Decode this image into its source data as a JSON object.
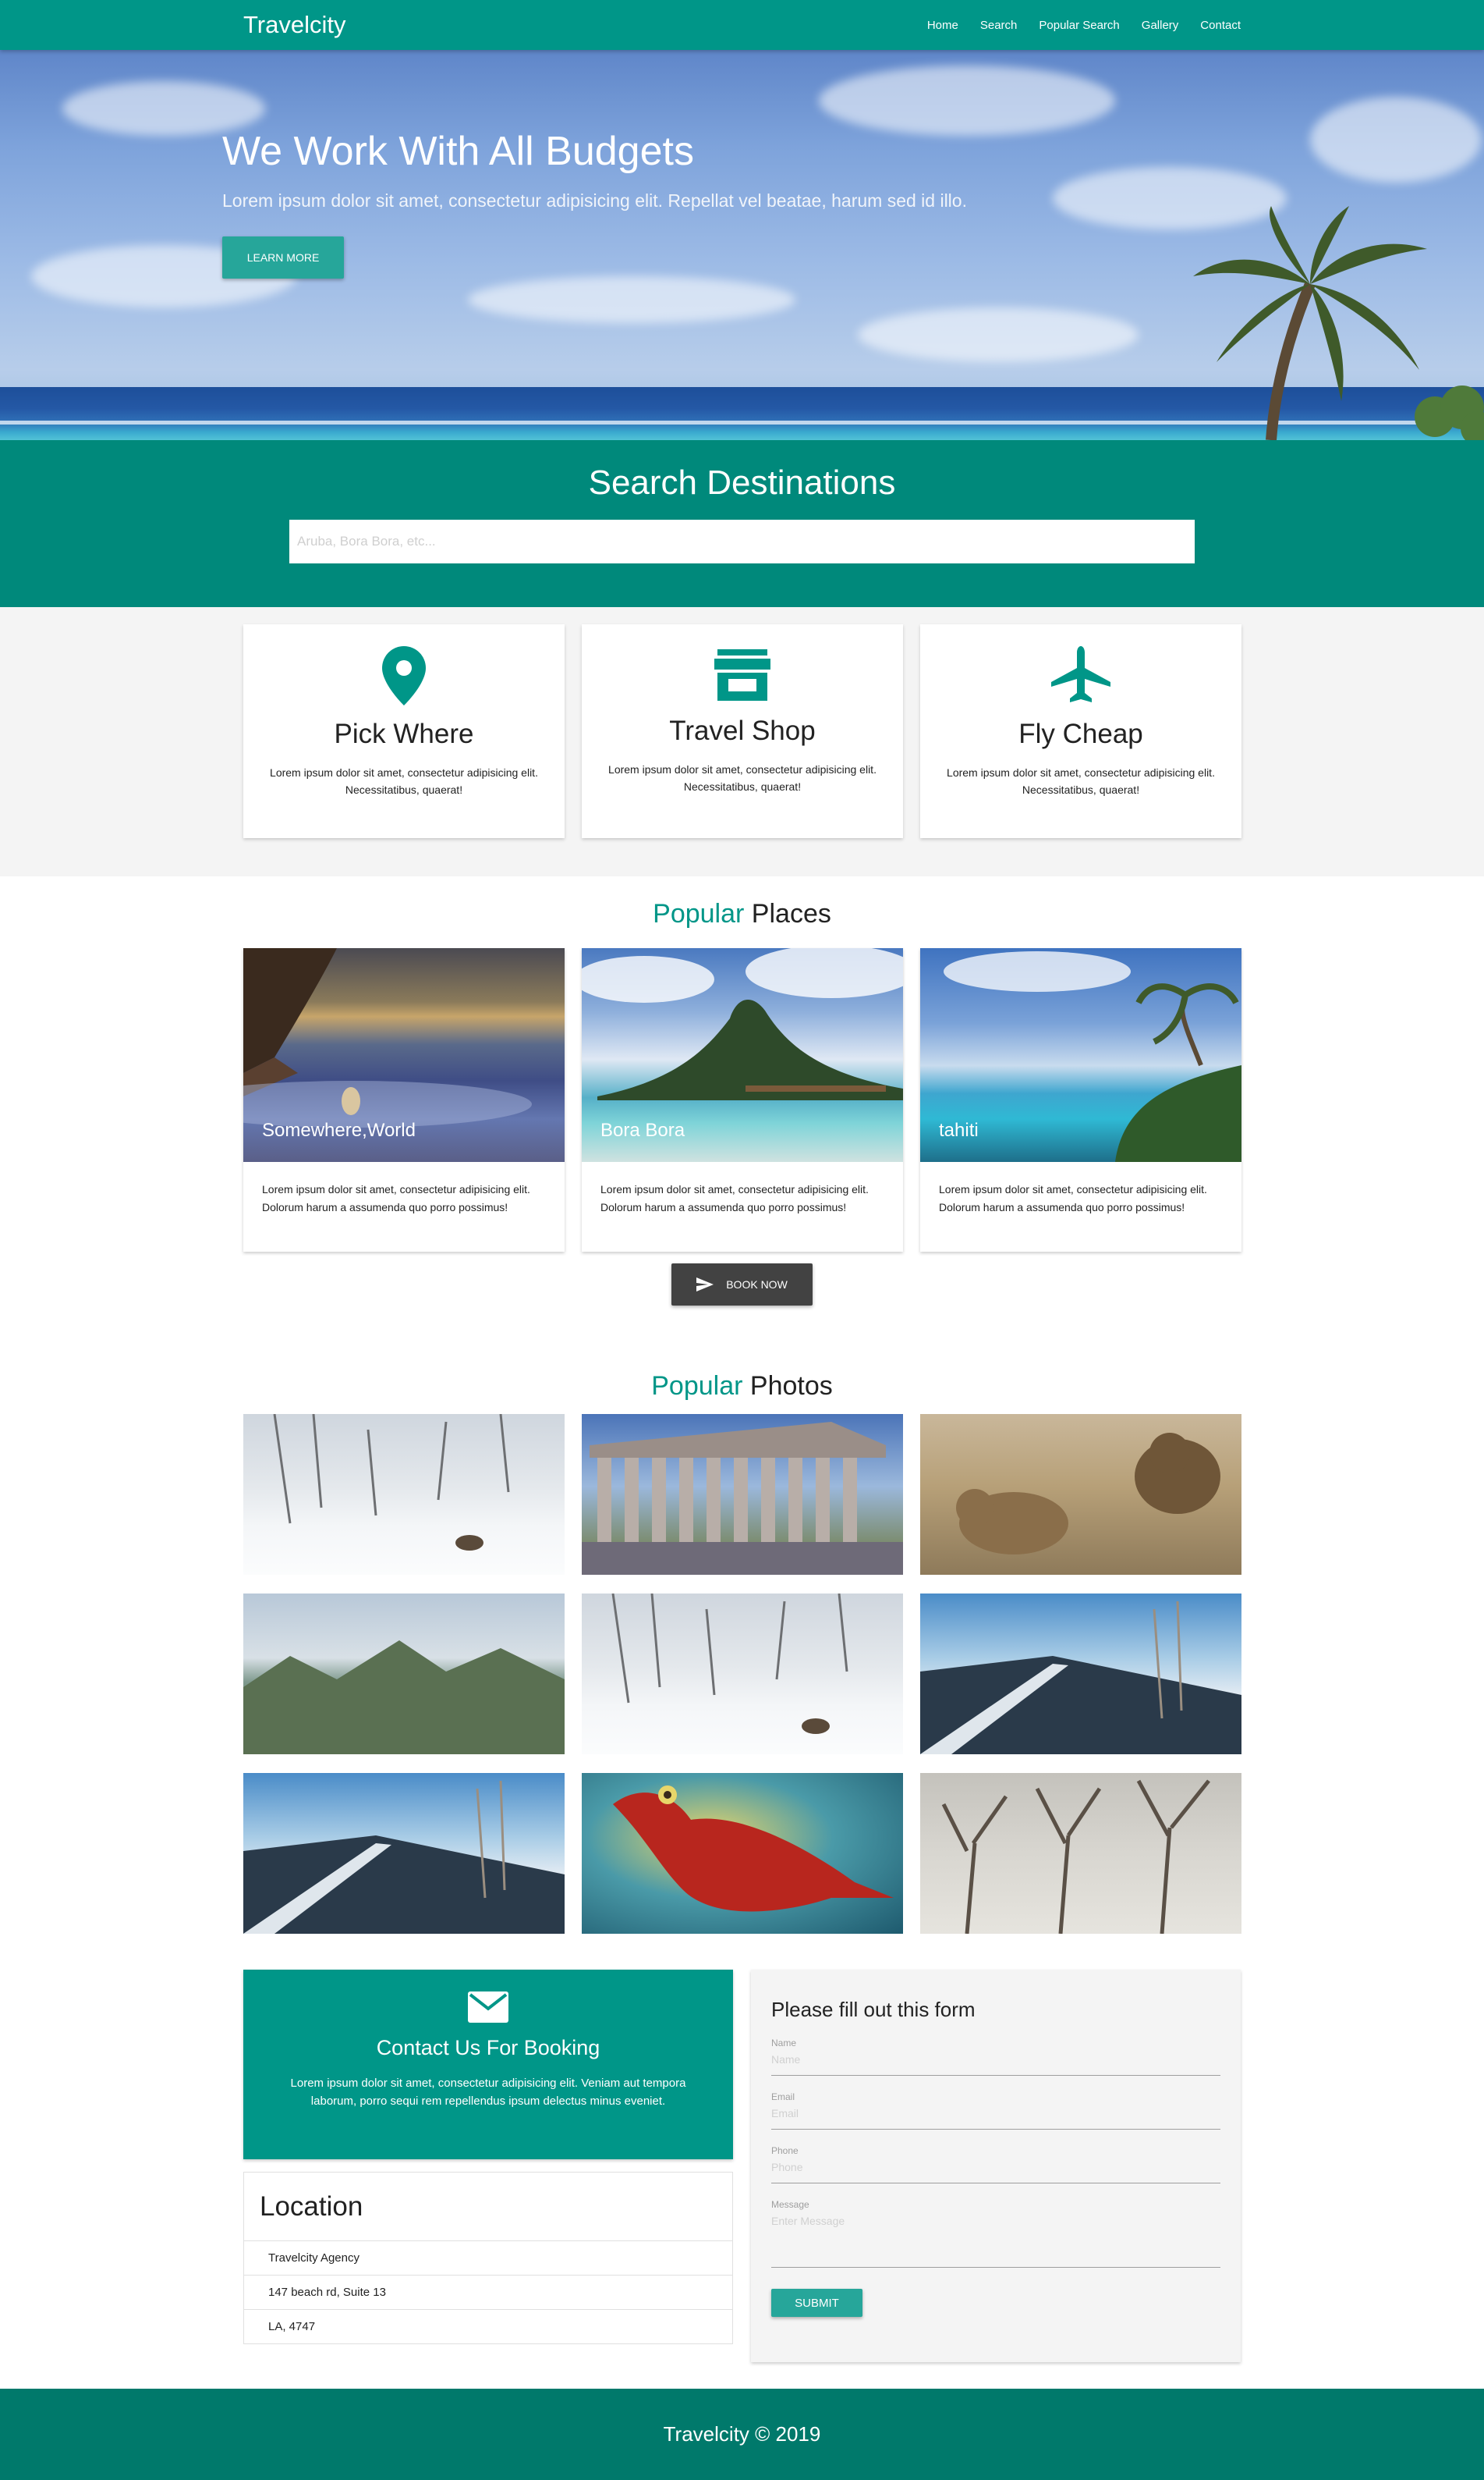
{
  "nav": {
    "brand": "Travelcity",
    "items": [
      "Home",
      "Search",
      "Popular Search",
      "Gallery",
      "Contact"
    ]
  },
  "hero": {
    "title": "We Work With All Budgets",
    "subtitle": "Lorem ipsum dolor sit amet, consectetur adipisicing elit. Repellat vel beatae, harum sed id illo.",
    "button": "Learn More"
  },
  "search": {
    "title": "Search Destinations",
    "placeholder": "Aruba, Bora Bora, etc..."
  },
  "features": [
    {
      "icon": "map-pin-icon",
      "title": "Pick Where",
      "text": "Lorem ipsum dolor sit amet, consectetur adipisicing elit. Necessitatibus, quaerat!"
    },
    {
      "icon": "store-icon",
      "title": "Travel Shop",
      "text": "Lorem ipsum dolor sit amet, consectetur adipisicing elit. Necessitatibus, quaerat!"
    },
    {
      "icon": "airplane-icon",
      "title": "Fly Cheap",
      "text": "Lorem ipsum dolor sit amet, consectetur adipisicing elit. Necessitatibus, quaerat!"
    }
  ],
  "places": {
    "title_accent": "Popular",
    "title_rest": "Places",
    "cards": [
      {
        "caption": "Somewhere,World",
        "text": "Lorem ipsum dolor sit amet, consectetur adipisicing elit. Dolorum harum a assumenda quo porro possimus!"
      },
      {
        "caption": "Bora Bora",
        "text": "Lorem ipsum dolor sit amet, consectetur adipisicing elit. Dolorum harum a assumenda quo porro possimus!"
      },
      {
        "caption": "tahiti",
        "text": "Lorem ipsum dolor sit amet, consectetur adipisicing elit. Dolorum harum a assumenda quo porro possimus!"
      }
    ],
    "button": "Book Now"
  },
  "photos": {
    "title_accent": "Popular",
    "title_rest": "Photos"
  },
  "contact": {
    "title": "Contact Us For Booking",
    "text": "Lorem ipsum dolor sit amet, consectetur adipisicing elit. Veniam aut tempora laborum, porro sequi rem repellendus ipsum delectus minus eveniet.",
    "location_title": "Location",
    "location_lines": [
      "Travelcity Agency",
      "147 beach rd, Suite 13",
      "LA, 4747"
    ]
  },
  "form": {
    "title": "Please fill out this form",
    "name_label": "Name",
    "name_placeholder": "Name",
    "email_label": "Email",
    "email_placeholder": "Email",
    "phone_label": "Phone",
    "phone_placeholder": "Phone",
    "message_label": "Message",
    "message_placeholder": "Enter Message",
    "submit": "Submit"
  },
  "footer": {
    "text": "Travelcity © 2019"
  },
  "colors": {
    "primary": "#009688",
    "primary_dark": "#00796b",
    "button": "#26a69a",
    "dark_button": "#424242"
  }
}
